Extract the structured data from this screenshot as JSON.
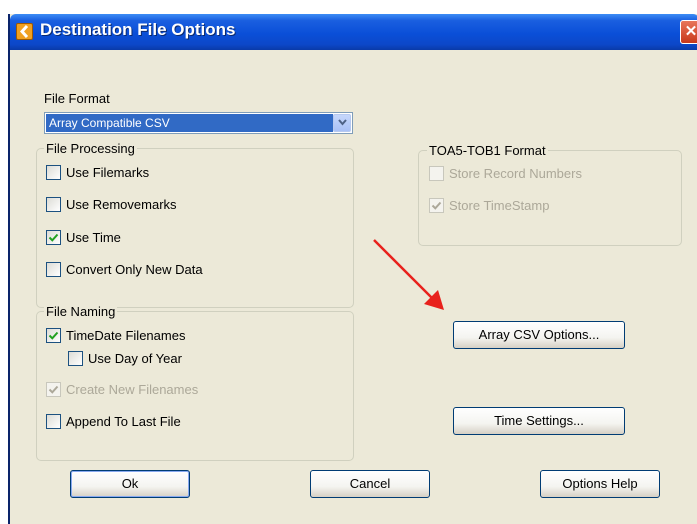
{
  "window": {
    "title": "Destination File Options",
    "close_symbol": "✕",
    "app_icon": "destination-app-icon"
  },
  "file_format": {
    "label": "File Format",
    "selected": "Array Compatible CSV"
  },
  "file_processing": {
    "legend": "File Processing",
    "options": [
      {
        "label": "Use Filemarks",
        "checked": false,
        "enabled": true
      },
      {
        "label": "Use Removemarks",
        "checked": false,
        "enabled": true
      },
      {
        "label": "Use Time",
        "checked": true,
        "enabled": true
      },
      {
        "label": "Convert Only New Data",
        "checked": false,
        "enabled": true
      }
    ]
  },
  "toa5_format": {
    "legend": "TOA5-TOB1 Format",
    "options": [
      {
        "label": "Store Record Numbers",
        "checked": false,
        "enabled": false
      },
      {
        "label": "Store TimeStamp",
        "checked": true,
        "enabled": false
      }
    ]
  },
  "file_naming": {
    "legend": "File Naming",
    "options": [
      {
        "label": "TimeDate Filenames",
        "checked": true,
        "enabled": true
      },
      {
        "label": "Use Day of Year",
        "checked": false,
        "enabled": true
      },
      {
        "label": "Create New Filenames",
        "checked": true,
        "enabled": false
      },
      {
        "label": "Append To Last File",
        "checked": false,
        "enabled": true
      }
    ]
  },
  "buttons": {
    "array_csv": "Array CSV Options...",
    "time_settings": "Time Settings...",
    "ok": "Ok",
    "cancel": "Cancel",
    "help": "Options Help"
  },
  "colors": {
    "annotation_arrow": "#e8211c",
    "titlebar": "#0a4fd8",
    "dialog_face": "#ece9d8"
  }
}
